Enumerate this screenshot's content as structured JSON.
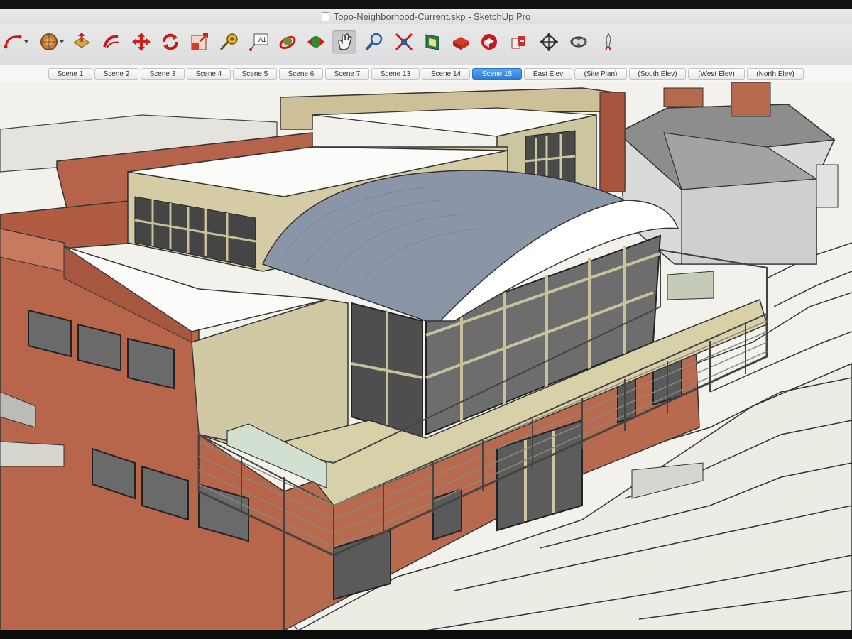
{
  "window": {
    "title": "Topo-Neighborhood-Current.skp - SketchUp Pro"
  },
  "toolbar": {
    "tools": [
      {
        "name": "arc-tool-icon"
      },
      {
        "name": "paint-bucket-icon"
      },
      {
        "name": "push-pull-icon"
      },
      {
        "name": "follow-me-icon"
      },
      {
        "name": "move-icon"
      },
      {
        "name": "rotate-icon"
      },
      {
        "name": "scale-icon"
      },
      {
        "name": "tape-measure-icon"
      },
      {
        "name": "text-tool-icon"
      },
      {
        "name": "orbit-icon"
      },
      {
        "name": "pan-icon"
      },
      {
        "name": "hand-tool-icon"
      },
      {
        "name": "zoom-icon"
      },
      {
        "name": "zoom-extents-icon"
      },
      {
        "name": "section-plane-icon"
      },
      {
        "name": "component-icon"
      },
      {
        "name": "3d-warehouse-icon"
      },
      {
        "name": "share-model-icon"
      },
      {
        "name": "position-camera-icon"
      },
      {
        "name": "look-around-icon"
      },
      {
        "name": "walk-icon"
      }
    ]
  },
  "scenes": {
    "tabs": [
      "Scene 1",
      "Scene 2",
      "Scene 3",
      "Scene 4",
      "Scene 5",
      "Scene 6",
      "Scene 7",
      "Scene 13",
      "Scene 14",
      "Scene 15",
      "East Elev",
      "(Site Plan)",
      "(South Elev)",
      "(West Elev)",
      "(North Elev)"
    ],
    "active": "Scene 15"
  },
  "colors": {
    "accent": "#3b8ee6",
    "brick": "#b46349",
    "siding": "#cfc6a1",
    "metal_roof": "#8792a4",
    "terrain": "#ebe9e2",
    "terrain_line": "#3a3a3a"
  }
}
